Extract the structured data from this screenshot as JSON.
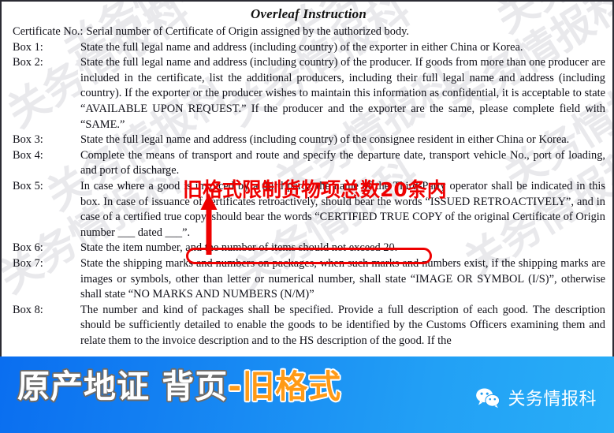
{
  "document": {
    "title": "Overleaf Instruction",
    "paragraphs": [
      {
        "label": "Certificate No.:",
        "label_wide": true,
        "text": "Serial number of Certificate of Origin assigned by the authorized body."
      },
      {
        "label": "Box 1:",
        "label_wide": false,
        "text": "State the full legal name and address (including country) of the exporter in either China or Korea."
      },
      {
        "label": "Box 2:",
        "label_wide": false,
        "text": "State the full legal name and address (including country) of the producer.    If goods from more than one producer are included in the certificate, list the additional producers, including their full legal name and address (including country).    If the exporter or the producer wishes to maintain this information as confidential, it is acceptable to state “AVAILABLE UPON REQUEST.”    If the producer and the exporter are the same, please complete field with “SAME.”"
      },
      {
        "label": "Box 3:",
        "label_wide": false,
        "text": "State the full legal name and address (including country) of the consignee resident in either China or Korea."
      },
      {
        "label": "Box 4:",
        "label_wide": false,
        "text": "Complete the means of transport and route and specify the departure date, transport vehicle No., port of loading, and port of discharge."
      },
      {
        "label": "Box 5:",
        "label_wide": false,
        "text": "In case where a good is invoiced by a third party, the name of the Third-Party operator shall be indicated in this box.    In case of issuance of certificates retroactively, should bear the words “ISSUED RETROACTIVELY”, and in case of a certified true copy, should bear the words “CERTIFIED TRUE COPY of the original Certificate of Origin number  ___  dated  ___”."
      },
      {
        "label": "Box 6:",
        "label_wide": false,
        "text": "State the item number, and the number of items should not exceed 20."
      },
      {
        "label": "Box 7:",
        "label_wide": false,
        "text": "State the shipping marks and numbers on packages, when such marks and numbers exist, if the shipping marks are images or symbols, other than letter or numerical number, shall state “IMAGE OR SYMBOL (I/S)”, otherwise shall state “NO MARKS AND NUMBERS (N/M)”"
      },
      {
        "label": "Box 8:",
        "label_wide": false,
        "text": "The number and kind of packages shall be specified.    Provide a full description of each good.    The description should be sufficiently detailed to enable the goods to be identified by the Customs Officers examining them and relate them to the invoice description and to the HS description of the good.    If the"
      }
    ],
    "watermark_text": "关务情报科"
  },
  "annotations": {
    "red_note": "旧格式限制货物项总数20条内",
    "red_color": "#ee0000",
    "oval_target": "and the number of items should not exceed 20.",
    "arrow_icon": "up-arrow-icon"
  },
  "banner": {
    "title_white": "原产地证 背页",
    "title_separator": "-",
    "title_orange": "旧格式",
    "wechat_icon": "wechat-icon",
    "wechat_label": "关务情报科",
    "gradient_start": "#0a6ef0",
    "gradient_end": "#28aef7",
    "orange": "#ff9a16"
  }
}
